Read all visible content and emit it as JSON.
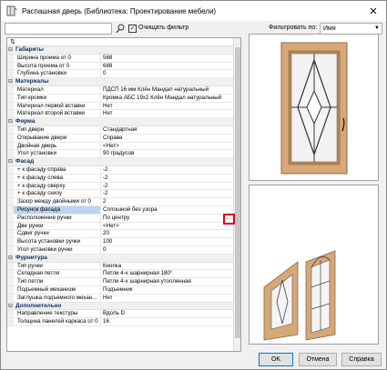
{
  "window": {
    "title": "Распашная дверь (Библиотека: Проектирование мебели)"
  },
  "toolbar": {
    "search_value": "",
    "clear_filter_label": "Очищать фильтр",
    "clear_filter_checked": true,
    "filter_by_label": "Фильтровать по:",
    "filter_by_value": "Имя"
  },
  "grid": {
    "sections": [
      {
        "label": "Габариты",
        "rows": [
          {
            "name": "Ширина проема от 0",
            "value": "568"
          },
          {
            "name": "Высота проема от 0",
            "value": "688"
          },
          {
            "name": "Глубина установки",
            "value": "0"
          }
        ]
      },
      {
        "label": "Материалы",
        "rows": [
          {
            "name": "Материал",
            "value": "ПДСП 16 мм Клён Мандал натуральный"
          },
          {
            "name": "Тип кромки",
            "value": "Кромка АБС 19х2 Клён Мандал натуральный"
          },
          {
            "name": "Материал первой вставки",
            "value": "Нет"
          },
          {
            "name": "Материал второй вставки",
            "value": "Нет"
          }
        ]
      },
      {
        "label": "Форма",
        "rows": [
          {
            "name": "Тип двери",
            "value": "Стандартная"
          },
          {
            "name": "Открывание двери",
            "value": "Справа"
          },
          {
            "name": "Двойная дверь",
            "value": "<Нет>"
          },
          {
            "name": "Угол установки",
            "value": "90 градусов"
          }
        ]
      },
      {
        "label": "Фасад",
        "rows": [
          {
            "name": "+ к фасаду справа",
            "value": "-2"
          },
          {
            "name": "+ к фасаду слева",
            "value": "-2"
          },
          {
            "name": "+ к фасаду сверху",
            "value": "-2"
          },
          {
            "name": "+ к фасаду снизу",
            "value": "-2"
          },
          {
            "name": "Зазор между двойными от 0",
            "value": "2"
          },
          {
            "name": "Рисунок фасада",
            "value": "Сплошной без узора",
            "selected": true
          },
          {
            "name": "Расположение ручки",
            "value": "По центру"
          },
          {
            "name": "Две ручки",
            "value": "<Нет>"
          },
          {
            "name": "Сдвиг ручки",
            "value": "20"
          },
          {
            "name": "Высота установки ручки",
            "value": "100"
          },
          {
            "name": "Угол установки ручки",
            "value": "0"
          }
        ]
      },
      {
        "label": "Фурнитура",
        "rows": [
          {
            "name": "Тип ручки",
            "value": "Кнопка"
          },
          {
            "name": "Складная петля",
            "value": "Петли 4-х шарнирная 180°"
          },
          {
            "name": "Тип петли",
            "value": "Петли 4-х шарнирная утопленная"
          },
          {
            "name": "Подъемный механизм",
            "value": "Подъемник"
          },
          {
            "name": "Заглушка подъемного механ...",
            "value": "Нет"
          }
        ]
      },
      {
        "label": "Дополнительно",
        "rows": [
          {
            "name": "Направление текстуры",
            "value": "Вдоль D"
          },
          {
            "name": "Толщина панелей каркаса от 0",
            "value": "16"
          }
        ]
      }
    ]
  },
  "buttons": {
    "ok": "OK",
    "cancel": "Отмена",
    "help": "Справка"
  },
  "colors": {
    "wood": "#d6a878",
    "wood_dark": "#b68452",
    "section_text": "#0d2f6b",
    "selection": "#bcd4ee",
    "highlight": "#e0001b"
  }
}
